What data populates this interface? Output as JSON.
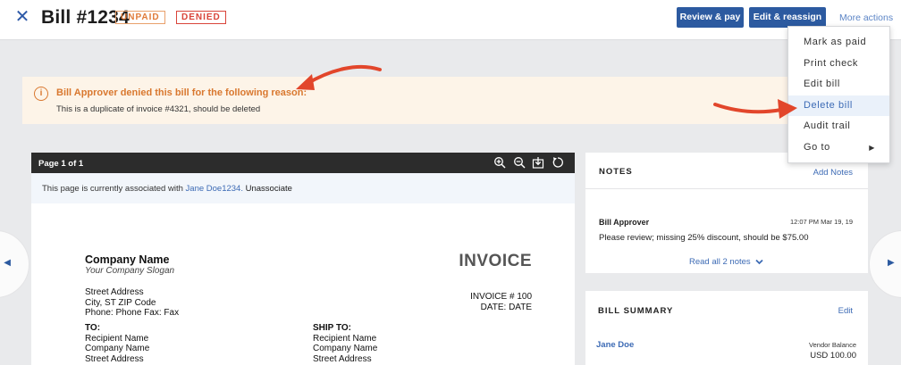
{
  "header": {
    "title": "Bill #1234",
    "badges": {
      "unpaid": "UNPAID",
      "denied": "DENIED"
    },
    "review_pay": "Review & pay",
    "edit_reassign": "Edit & reassign",
    "more_actions": "More actions"
  },
  "dropdown": {
    "items": [
      {
        "label": "Mark as paid"
      },
      {
        "label": "Print check"
      },
      {
        "label": "Edit bill"
      },
      {
        "label": "Delete bill"
      },
      {
        "label": "Audit trail"
      },
      {
        "label": "Go to"
      }
    ],
    "active_index": 3
  },
  "alert": {
    "title": "Bill Approver denied this bill for the following reason:",
    "body": "This is a duplicate of invoice #4321, should be deleted"
  },
  "viewer": {
    "page_label": "Page 1 of 1",
    "assoc_prefix": "This page is currently associated with ",
    "assoc_link": "Jane Doe1234.",
    "unassociate": "Unassociate"
  },
  "invoice": {
    "company_name": "Company Name",
    "slogan": "Your Company Slogan",
    "heading": "INVOICE",
    "address": [
      "Street Address",
      "City, ST ZIP Code",
      "Phone: Phone Fax: Fax"
    ],
    "number": "INVOICE # 100",
    "date": "DATE: DATE",
    "to_heading": "TO:",
    "to_lines": [
      "Recipient Name",
      "Company Name",
      "Street Address"
    ],
    "ship_heading": "SHIP TO:",
    "ship_lines": [
      "Recipient Name",
      "Company Name",
      "Street Address"
    ]
  },
  "notes": {
    "heading": "NOTES",
    "add_label": "Add Notes",
    "author": "Bill Approver",
    "timestamp": "12:07 PM Mar 19, 19",
    "text": "Please review; missing 25% discount, should be $75.00",
    "read_all": "Read all 2 notes"
  },
  "summary": {
    "heading": "BILL SUMMARY",
    "edit_label": "Edit",
    "vendor": "Jane Doe",
    "balance_label": "Vendor Balance",
    "balance_value": "USD 100.00"
  },
  "colors": {
    "primary": "#2c5aa0",
    "link": "#3d6bb5",
    "warning": "#d9782f",
    "danger": "#d9443a",
    "annotation_arrow": "#e2462b"
  },
  "icons": [
    "close-icon",
    "info-icon",
    "zoom-in-icon",
    "zoom-out-icon",
    "download-icon",
    "rotate-icon",
    "chevron-down-icon",
    "caret-right-icon",
    "prev-arrow-icon",
    "next-arrow-icon"
  ]
}
